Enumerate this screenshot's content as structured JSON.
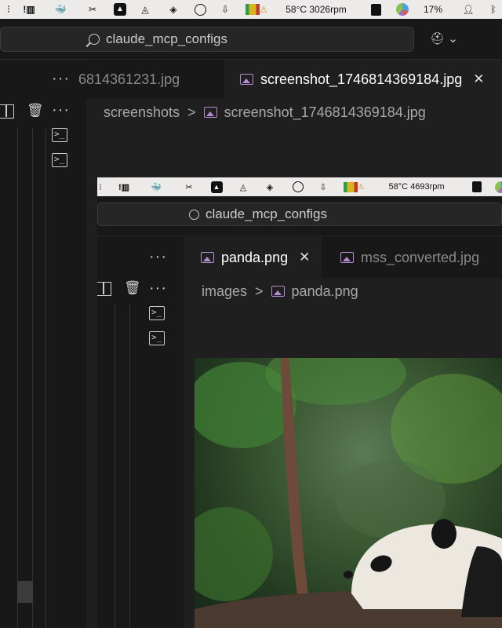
{
  "outer": {
    "menubar": {
      "temp_rpm": "58°C 3026rpm",
      "percent": "17%"
    },
    "search": {
      "text": "claude_mcp_configs"
    },
    "more": "···",
    "tabs": [
      {
        "label": "6814361231.jpg",
        "active": false
      },
      {
        "label": "screenshot_1746814369184.jpg",
        "active": true,
        "close": "✕"
      }
    ],
    "breadcrumb": {
      "folder": "screenshots",
      "sep": ">",
      "file": "screenshot_1746814369184.jpg"
    }
  },
  "inner": {
    "menubar": {
      "temp_rpm": "58°C 4693rpm"
    },
    "search": {
      "text": "claude_mcp_configs"
    },
    "more": "···",
    "tabs": [
      {
        "label": "panda.png",
        "active": true,
        "close": "✕"
      },
      {
        "label": "mss_converted.jpg",
        "active": false
      }
    ],
    "breadcrumb": {
      "folder": "images",
      "sep": ">",
      "file": "panda.png"
    }
  },
  "colors": {
    "editor_bg": "#1f1f1f",
    "sidebar_bg": "#181818",
    "active_tab_bg": "#1f1f1f",
    "image_icon": "#b58ccf"
  },
  "icons": [
    "search-icon",
    "copilot-icon",
    "split-editor-icon",
    "trash-icon",
    "terminal-icon",
    "image-file-icon",
    "close-icon",
    "bluetooth-icon",
    "battery-icon"
  ]
}
